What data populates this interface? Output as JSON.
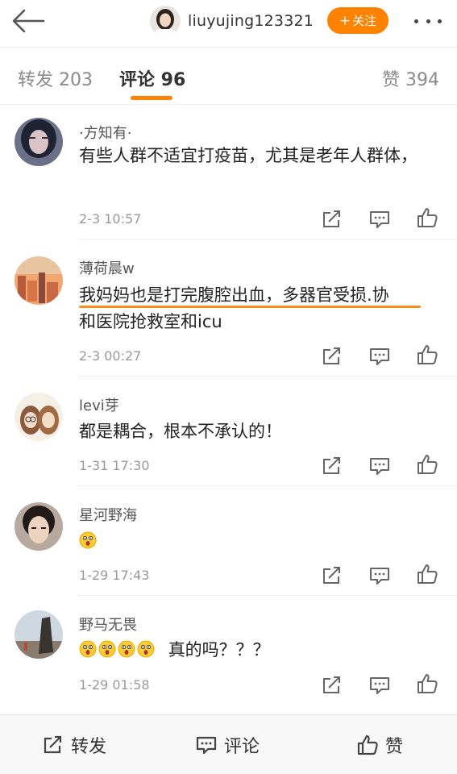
{
  "header": {
    "username": "liuyujing123321",
    "follow_label": "关注",
    "follow_plus": "+",
    "accent_color": "#ff8200"
  },
  "tabs": {
    "repost": "转发 203",
    "comment": "评论 96",
    "like": "赞 394"
  },
  "comments": [
    {
      "name": "·方知有·",
      "text": "有些人群不适宜打疫苗，尤其是老年人群体，",
      "time": "2-3 10:57"
    },
    {
      "name": "薄荷晨w",
      "text_line1": "我妈妈也是打完腹腔出血，多器官受损.协",
      "text_line2": "和医院抢救室和icu",
      "time": "2-3 00:27"
    },
    {
      "name": "levi芽",
      "text": "都是耦合，根本不承认的！",
      "time": "1-31 17:30"
    },
    {
      "name": "星河野海",
      "text": "",
      "emoji_count": 1,
      "time": "1-29 17:43"
    },
    {
      "name": "野马无畏",
      "text": "真的吗？？？",
      "emoji_count": 4,
      "time": "1-29 01:58"
    }
  ],
  "icons": {
    "back": "arrow-left-icon",
    "share": "share-icon",
    "reply": "comment-icon",
    "like": "thumbs-up-icon",
    "emoji": "astonished-face-emoji"
  },
  "bottom_bar": {
    "repost": "转发",
    "comment": "评论",
    "like": "赞"
  }
}
